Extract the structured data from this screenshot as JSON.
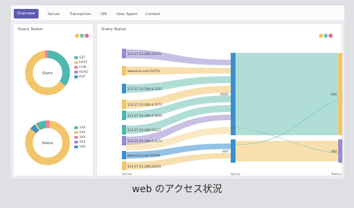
{
  "tabs": [
    "Overview",
    "Server",
    "Transaction",
    "URI",
    "User Agent",
    "Context"
  ],
  "left_panel": {
    "title": "Query Status",
    "donut1": {
      "center": "Query",
      "legend": [
        {
          "label": "GET",
          "color": "#4db8b0"
        },
        {
          "label": "POST",
          "color": "#f2c56b"
        },
        {
          "label": "CON...",
          "color": "#ec7fa0"
        },
        {
          "label": "HEAD",
          "color": "#9b8ad0"
        },
        {
          "label": "PUT",
          "color": "#3a8fcf"
        }
      ]
    },
    "donut2": {
      "center": "Status",
      "legend": [
        {
          "label": "1XX",
          "color": "#4db8b0"
        },
        {
          "label": "2XX",
          "color": "#f2c56b"
        },
        {
          "label": "3XX",
          "color": "#ec7fa0"
        },
        {
          "label": "4XX",
          "color": "#9b8ad0"
        },
        {
          "label": "5XX",
          "color": "#3a8fcf"
        }
      ]
    }
  },
  "right_panel": {
    "title": "Query Status",
    "servers": [
      "123.27.23.208:23743",
      "www.tiva.com:14752",
      "123.27.23.208:4:1333",
      "123.27.23.208:4:1573",
      "123.27.23.208:4:1920",
      "123.27.23.208:23237",
      "123.27.23.208:4:1573",
      "www.tiva.com:13295",
      "123.27.23.208:23431"
    ],
    "middle_labels": [
      "POST",
      "GET"
    ],
    "right_labels": [
      "200",
      "300"
    ],
    "axis": [
      "Server",
      "Query",
      "Status"
    ]
  },
  "dots_colors": [
    "#f0c35a",
    "#6fc3b7",
    "#e36a8f"
  ],
  "caption": "web のアクセス状況"
}
